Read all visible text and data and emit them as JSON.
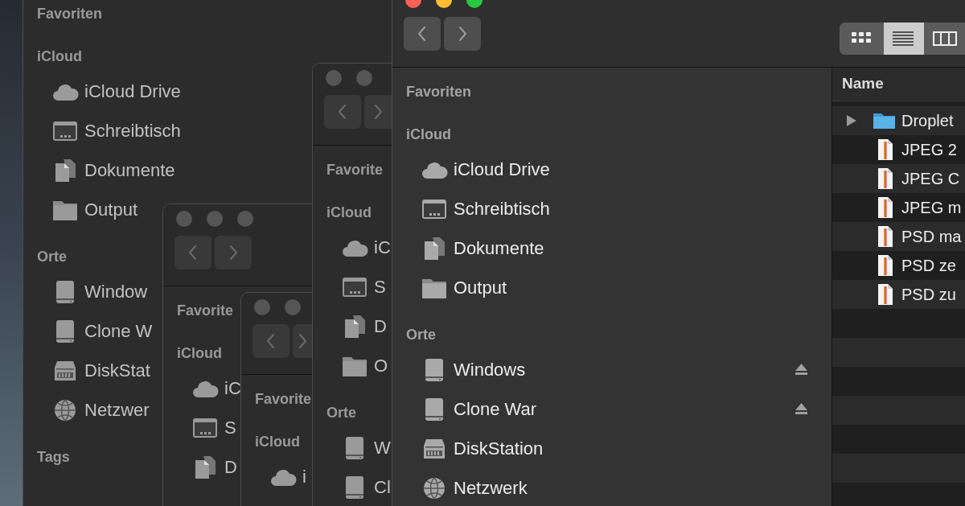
{
  "windows": [
    {
      "active": false,
      "sidebar": [
        {
          "title": "Favoriten"
        },
        {
          "title": "iCloud",
          "items": [
            {
              "label": "iCloud Drive",
              "kind": "cloud"
            },
            {
              "label": "Schreibtisch",
              "kind": "desktop"
            },
            {
              "label": "Dokumente",
              "kind": "documents"
            },
            {
              "label": "Output",
              "kind": "folder"
            }
          ]
        },
        {
          "title": "Orte",
          "items": [
            {
              "label": "Window",
              "kind": "drive"
            },
            {
              "label": "Clone W",
              "kind": "drive"
            },
            {
              "label": "DiskStat",
              "kind": "server"
            },
            {
              "label": "Netzwer",
              "kind": "globe"
            }
          ]
        },
        {
          "title": "Tags"
        }
      ]
    },
    {
      "active": false,
      "toolbar": {
        "window_buttons": [
          {
            "kind": "close"
          },
          {
            "kind": "minimize"
          },
          {
            "kind": "zoom"
          }
        ]
      },
      "sidebar": [
        {
          "title": "Favorite"
        },
        {
          "title": "iCloud",
          "items": [
            {
              "label": "iC",
              "kind": "cloud"
            },
            {
              "label": "S",
              "kind": "desktop"
            },
            {
              "label": "D",
              "kind": "documents"
            }
          ]
        }
      ]
    },
    {
      "active": false,
      "toolbar": {
        "window_buttons": [
          {
            "kind": "close"
          },
          {
            "kind": "minimize"
          }
        ]
      },
      "sidebar": [
        {
          "title": "Favorite"
        },
        {
          "title": "iCloud",
          "items": [
            {
              "label": "i",
              "kind": "cloud"
            }
          ]
        }
      ]
    },
    {
      "active": false,
      "toolbar": {
        "window_buttons": [
          {
            "kind": "close"
          },
          {
            "kind": "minimize"
          }
        ]
      },
      "sidebar": [
        {
          "title": "Favorite"
        },
        {
          "title": "iCloud",
          "items": [
            {
              "label": "iC",
              "kind": "cloud"
            },
            {
              "label": "S",
              "kind": "desktop"
            },
            {
              "label": "D",
              "kind": "documents"
            },
            {
              "label": "O",
              "kind": "folder"
            }
          ]
        },
        {
          "title": "Orte",
          "items": [
            {
              "label": "W",
              "kind": "drive"
            },
            {
              "label": "Cl",
              "kind": "drive"
            }
          ]
        }
      ]
    },
    {
      "active": true,
      "toolbar": {
        "window_buttons": [
          {
            "kind": "close"
          },
          {
            "kind": "minimize"
          },
          {
            "kind": "zoom"
          }
        ],
        "view_modes": [
          {
            "kind": "icons",
            "selected": false
          },
          {
            "kind": "list",
            "selected": true
          },
          {
            "kind": "columns",
            "selected": false
          }
        ]
      },
      "sidebar": [
        {
          "title": "Favoriten"
        },
        {
          "title": "iCloud",
          "items": [
            {
              "label": "iCloud Drive",
              "kind": "cloud"
            },
            {
              "label": "Schreibtisch",
              "kind": "desktop"
            },
            {
              "label": "Dokumente",
              "kind": "documents"
            },
            {
              "label": "Output",
              "kind": "folder"
            }
          ]
        },
        {
          "title": "Orte",
          "items": [
            {
              "label": "Windows",
              "kind": "drive",
              "eject": true
            },
            {
              "label": "Clone War",
              "kind": "drive",
              "eject": true
            },
            {
              "label": "DiskStation",
              "kind": "server",
              "eject": false
            },
            {
              "label": "Netzwerk",
              "kind": "globe",
              "eject": false
            }
          ]
        }
      ],
      "file_list": {
        "columns": [
          "Name"
        ],
        "rows": [
          {
            "name": "Droplet",
            "kind": "folder",
            "expandable": true
          },
          {
            "name": "JPEG 2",
            "kind": "file",
            "expandable": false
          },
          {
            "name": "JPEG C",
            "kind": "file",
            "expandable": false
          },
          {
            "name": "JPEG m",
            "kind": "file",
            "expandable": false
          },
          {
            "name": "PSD ma",
            "kind": "file",
            "expandable": false
          },
          {
            "name": "PSD ze",
            "kind": "file",
            "expandable": false
          },
          {
            "name": "PSD zu",
            "kind": "file",
            "expandable": false
          }
        ]
      }
    }
  ]
}
